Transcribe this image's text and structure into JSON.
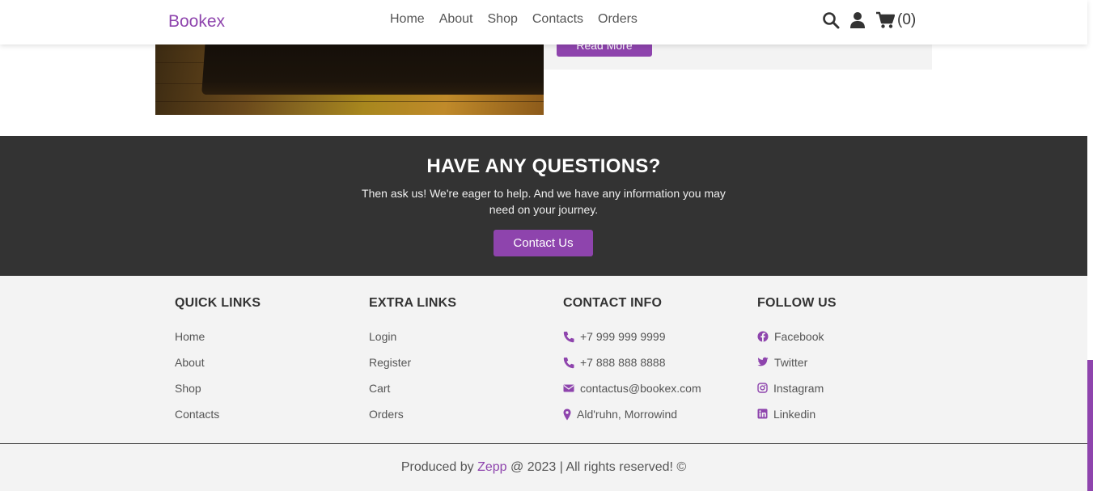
{
  "header": {
    "logo": "Bookex",
    "nav": [
      "Home",
      "About",
      "Shop",
      "Contacts",
      "Orders"
    ],
    "icons": [
      "search-icon",
      "user-icon",
      "cart-icon"
    ],
    "cart_count": "(0)"
  },
  "post": {
    "read_more": "Read More"
  },
  "questions": {
    "title": "HAVE ANY QUESTIONS?",
    "text": "Then ask us! We're eager to help. And we have any information you may need on your journey.",
    "button": "Contact Us"
  },
  "footer": {
    "quick_links": {
      "title": "QUICK LINKS",
      "items": [
        "Home",
        "About",
        "Shop",
        "Contacts"
      ]
    },
    "extra_links": {
      "title": "EXTRA LINKS",
      "items": [
        "Login",
        "Register",
        "Cart",
        "Orders"
      ]
    },
    "contact_info": {
      "title": "CONTACT INFO",
      "items": [
        {
          "icon": "phone-icon",
          "text": "+7 999 999 9999"
        },
        {
          "icon": "phone-icon",
          "text": "+7 888 888 8888"
        },
        {
          "icon": "envelope-icon",
          "text": "contactus@bookex.com"
        },
        {
          "icon": "map-pin-icon",
          "text": "Ald'ruhn, Morrowind"
        }
      ]
    },
    "follow_us": {
      "title": "FOLLOW US",
      "items": [
        {
          "icon": "facebook-icon",
          "text": "Facebook"
        },
        {
          "icon": "twitter-icon",
          "text": "Twitter"
        },
        {
          "icon": "instagram-icon",
          "text": "Instagram"
        },
        {
          "icon": "linkedin-icon",
          "text": "Linkedin"
        }
      ]
    },
    "credit": {
      "prefix": "Produced by ",
      "brand": "Zepp",
      "suffix": " @ 2023 | All rights reserved! ©"
    }
  },
  "colors": {
    "accent": "#8e44ad",
    "dark_band": "#333333",
    "footer_bg": "#f3f3f3"
  }
}
